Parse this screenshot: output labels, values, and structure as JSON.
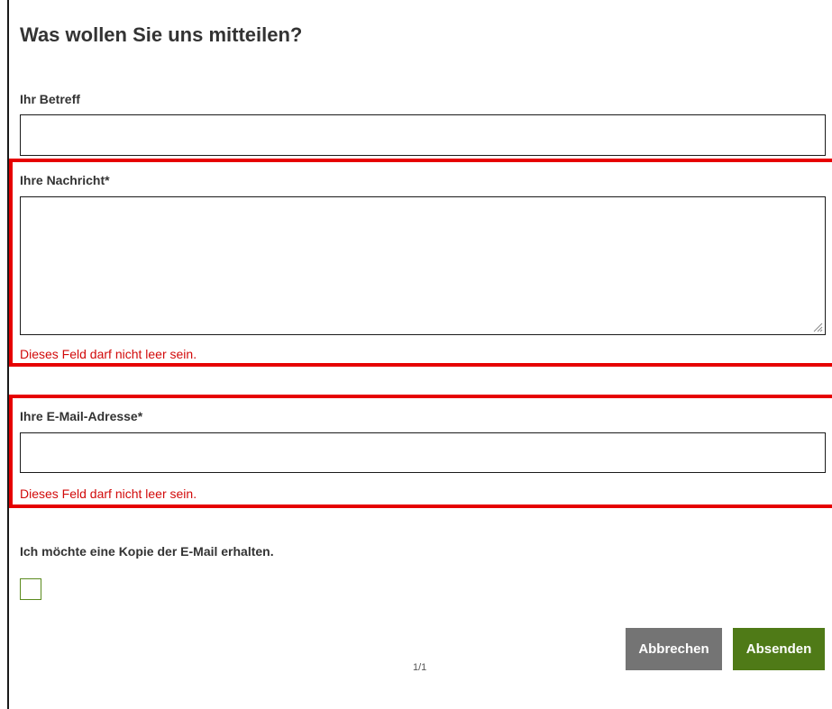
{
  "form": {
    "title": "Was wollen Sie uns mitteilen?",
    "subject": {
      "label": "Ihr Betreff",
      "value": ""
    },
    "message": {
      "label": "Ihre Nachricht*",
      "value": "",
      "error": "Dieses Feld darf nicht leer sein."
    },
    "email": {
      "label": "Ihre E-Mail-Adresse*",
      "value": "",
      "error": "Dieses Feld darf nicht leer sein."
    },
    "copy": {
      "label": "Ich möchte eine Kopie der E-Mail erhalten.",
      "checked": false
    },
    "buttons": {
      "cancel": "Abbrechen",
      "submit": "Absenden"
    },
    "pager": "1/1"
  },
  "colors": {
    "error": "#e60000",
    "submit": "#4f7a17",
    "cancel": "#747474"
  }
}
